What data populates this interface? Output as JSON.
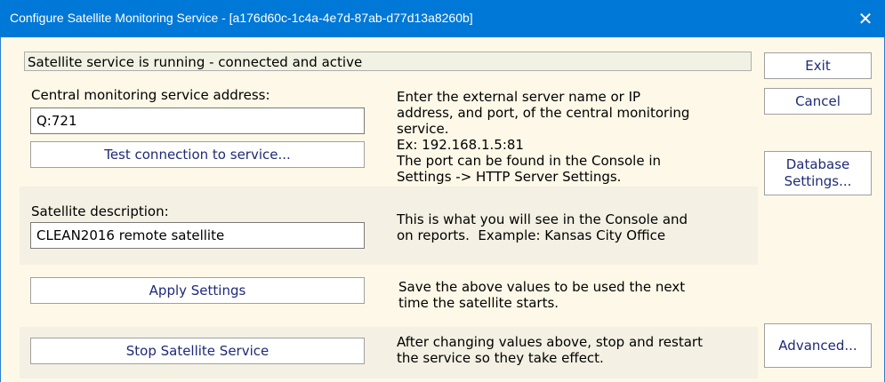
{
  "window": {
    "title": "Configure Satellite Monitoring Service - [a176d60c-1c4a-4e7d-87ab-d77d13a8260b]",
    "close_glyph": "✕"
  },
  "status_text": "Satellite service is running - connected and active",
  "central": {
    "label": "Central monitoring service address:",
    "value": "Q:721",
    "test_button": "Test connection to service...",
    "description": "Enter the external server name or IP\naddress, and port, of the central monitoring\nservice.\nEx: 192.168.1.5:81\nThe port can be found in the Console in\nSettings -> HTTP Server Settings."
  },
  "satellite": {
    "label": "Satellite description:",
    "value": "CLEAN2016 remote satellite",
    "description": "This is what you will see in the Console and\non reports.  Example: Kansas City Office"
  },
  "apply": {
    "button": "Apply Settings",
    "description": "Save the above values to be used the next\ntime the satellite starts."
  },
  "stop": {
    "button": "Stop Satellite Service",
    "description": "After changing values above, stop and restart\nthe service so they take effect."
  },
  "side_buttons": {
    "exit": "Exit",
    "cancel": "Cancel",
    "database": "Database\nSettings...",
    "advanced": "Advanced..."
  }
}
